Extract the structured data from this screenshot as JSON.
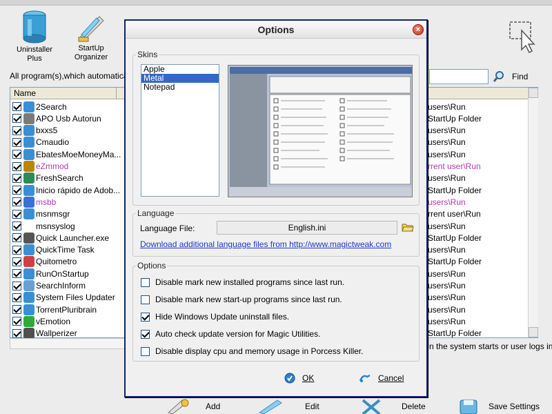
{
  "toolbar": {
    "uninstaller_label": "Uninstaller\nPlus",
    "startup_label": "StartUp\nOrganizer"
  },
  "description": "All program(s),which automatically",
  "find_label": "Find",
  "list": {
    "col_name": "Name",
    "rows": [
      {
        "name": "2Search",
        "checked": true,
        "pink": false,
        "right": "users\\Run"
      },
      {
        "name": "APO Usb Autorun",
        "checked": true,
        "pink": false,
        "right": "StartUp Folder"
      },
      {
        "name": "bxxs5",
        "checked": true,
        "pink": false,
        "right": "users\\Run"
      },
      {
        "name": "Cmaudio",
        "checked": true,
        "pink": false,
        "right": "users\\Run"
      },
      {
        "name": "EbatesMoeMoneyMa...",
        "checked": true,
        "pink": false,
        "right": "users\\Run"
      },
      {
        "name": "eZmmod",
        "checked": true,
        "pink": true,
        "right": "rrent user\\Run"
      },
      {
        "name": "FreshSearch",
        "checked": true,
        "pink": false,
        "right": "users\\Run"
      },
      {
        "name": "Inicio rápido de Adob...",
        "checked": true,
        "pink": false,
        "right": "StartUp Folder"
      },
      {
        "name": "msbb",
        "checked": true,
        "pink": true,
        "right": "users\\Run"
      },
      {
        "name": "msnmsgr",
        "checked": true,
        "pink": false,
        "right": "rrent user\\Run"
      },
      {
        "name": "msnsyslog",
        "checked": true,
        "pink": false,
        "right": "users\\Run"
      },
      {
        "name": "Quick Launcher.exe",
        "checked": true,
        "pink": false,
        "right": "StartUp Folder"
      },
      {
        "name": "QuickTime Task",
        "checked": true,
        "pink": false,
        "right": "users\\Run"
      },
      {
        "name": "Quitometro",
        "checked": true,
        "pink": false,
        "right": "StartUp Folder"
      },
      {
        "name": "RunOnStartup",
        "checked": true,
        "pink": false,
        "right": "users\\Run"
      },
      {
        "name": "SearchInform",
        "checked": true,
        "pink": false,
        "right": "users\\Run"
      },
      {
        "name": "System Files Updater",
        "checked": true,
        "pink": false,
        "right": "users\\Run"
      },
      {
        "name": "TorrentPluribrain",
        "checked": true,
        "pink": false,
        "right": "users\\Run"
      },
      {
        "name": "vEmotion",
        "checked": true,
        "pink": false,
        "right": "users\\Run"
      },
      {
        "name": "Wallperizer",
        "checked": true,
        "pink": false,
        "right": "StartUp Folder"
      }
    ]
  },
  "status_text": "n the system starts or user logs in",
  "bottom": {
    "add": "Add",
    "edit": "Edit",
    "delete": "Delete",
    "save": "Save Settings"
  },
  "dialog": {
    "title": "Options",
    "skins_legend": "Skins",
    "skins": [
      "Apple",
      "Metal",
      "Notepad"
    ],
    "selected_skin": "Metal",
    "language_legend": "Language",
    "language_file_label": "Language File:",
    "language_file_value": "English.ini",
    "download_link": "Download additional language files from http://www.magictweak.com",
    "options_legend": "Options",
    "options": [
      {
        "label": "Disable mark new installed programs since last run.",
        "checked": false
      },
      {
        "label": "Disable mark new start-up programs since last run.",
        "checked": false
      },
      {
        "label": "Hide Windows Update uninstall files.",
        "checked": true
      },
      {
        "label": "Auto check update version for Magic Utilities.",
        "checked": true
      },
      {
        "label": "Disable display cpu and memory usage in Porcess Killer.",
        "checked": false
      }
    ],
    "ok_label": "OK",
    "cancel_label": "Cancel"
  },
  "colors": {
    "pink": "#b13ab1",
    "selection": "#316ac5",
    "link": "#1c38c4"
  }
}
